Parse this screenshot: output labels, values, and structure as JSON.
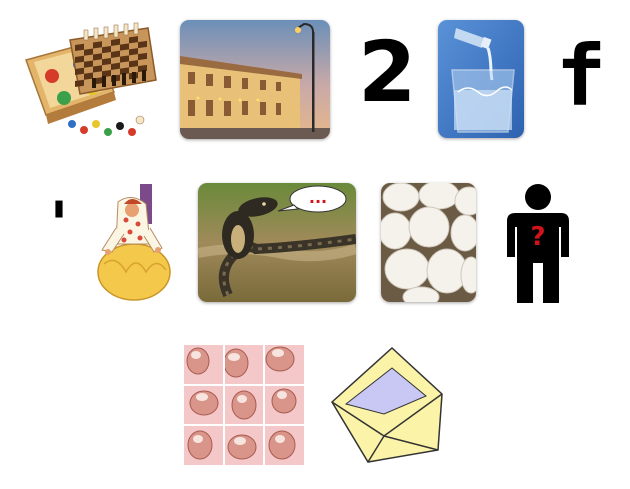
{
  "puzzle": {
    "row1": {
      "games_board": {
        "icon": "board-games-icon"
      },
      "station": {
        "icon": "train-station-photo"
      },
      "number": "2",
      "water": {
        "icon": "water-glass-photo"
      },
      "letter": "f"
    },
    "row2": {
      "apostrophe": "'",
      "genie": {
        "icon": "genie-cartoon-icon"
      },
      "snake": {
        "icon": "cobra-photo",
        "speech": "..."
      },
      "eggs": {
        "icon": "eggs-photo"
      },
      "person": {
        "icon": "unknown-person-icon",
        "mark": "?"
      }
    },
    "row3": {
      "toes": {
        "icon": "toes-puzzle-photo"
      },
      "envelope": {
        "icon": "open-envelope-icon"
      }
    }
  },
  "colors": {
    "sky_top": "#6b8fb8",
    "sky_bottom": "#e7b88a",
    "building": "#e8c078",
    "water_bg": "#3d78c8",
    "snake_bg": "#7a6a3a",
    "eggs_bg": "#6b5a44",
    "person_mark": "#d0141a",
    "envelope_fill": "#fbf4a8",
    "envelope_inner": "#c9c8f4",
    "skin": "#e4a89a"
  }
}
